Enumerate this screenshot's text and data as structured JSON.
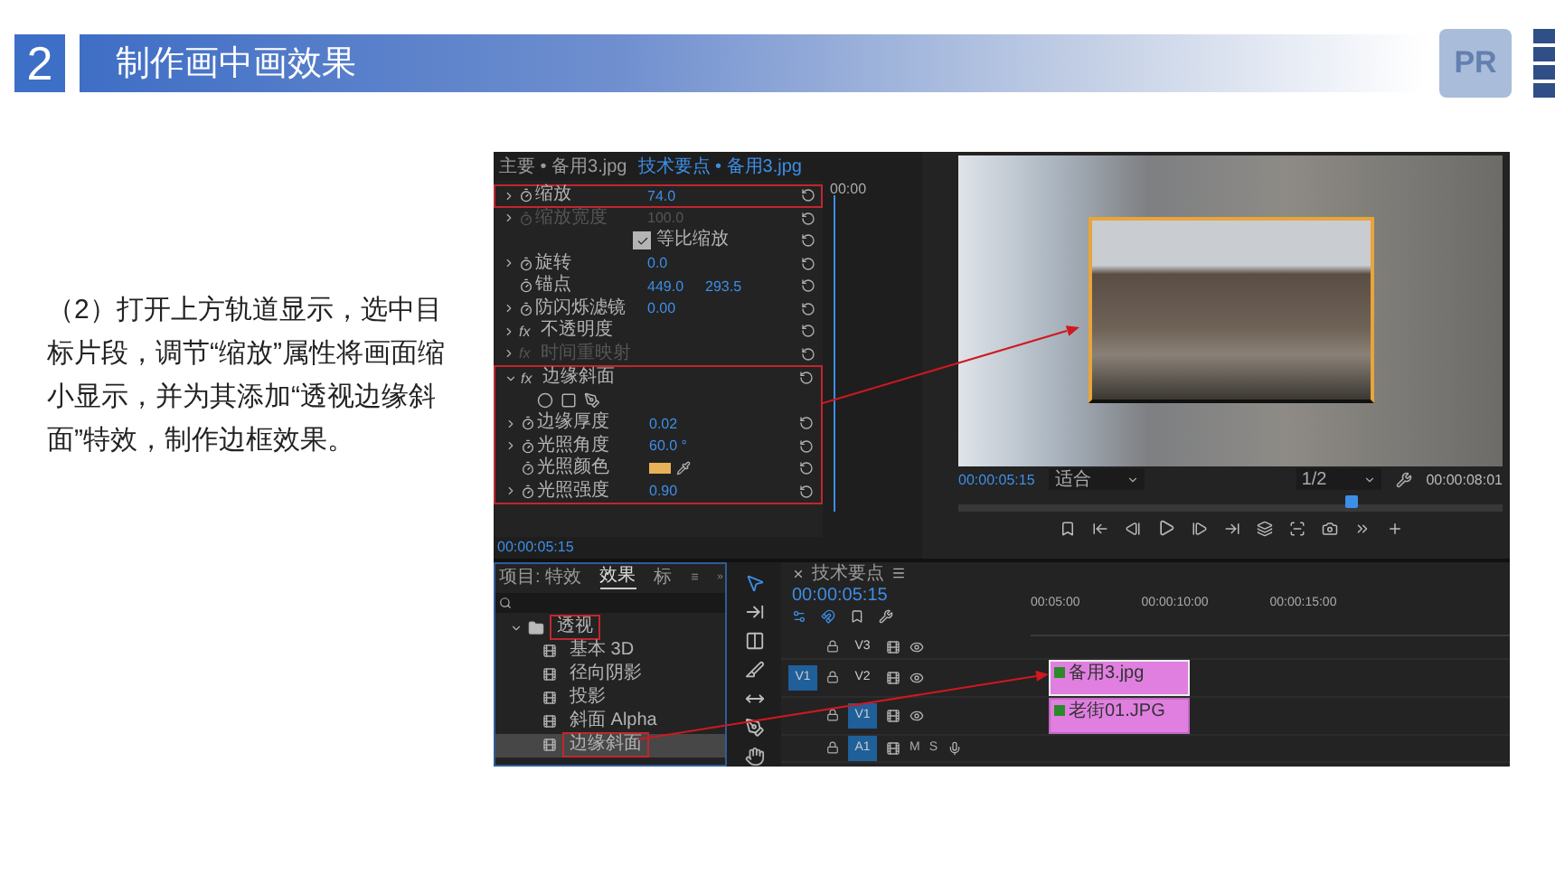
{
  "header": {
    "number": "2",
    "title": "制作画中画效果",
    "logo": "PR"
  },
  "instruction": "（2）打开上方轨道显示，选中目标片段，调节“缩放”属性将画面缩小显示，并为其添加“透视边缘斜面”特效，制作边框效果。",
  "effect_controls": {
    "tabs": [
      {
        "label": "主要 • 备用3.jpg",
        "selected": false
      },
      {
        "label": "技术要点 • 备用3.jpg",
        "selected": true
      }
    ],
    "ruler_label": "00:00",
    "rows": [
      {
        "kind": "property",
        "label": "缩放",
        "values": [
          "74.0"
        ],
        "expandable": true,
        "disabled": false,
        "highlighted": true
      },
      {
        "kind": "property",
        "label": "缩放宽度",
        "values": [
          "100.0"
        ],
        "expandable": true,
        "disabled": true,
        "highlighted": false
      },
      {
        "kind": "checkbox",
        "label": "等比缩放",
        "checked": true
      },
      {
        "kind": "property",
        "label": "旋转",
        "values": [
          "0.0"
        ],
        "expandable": true,
        "disabled": false,
        "highlighted": false
      },
      {
        "kind": "property",
        "label": "锚点",
        "values": [
          "449.0",
          "293.5"
        ],
        "expandable": false,
        "disabled": false,
        "highlighted": false
      },
      {
        "kind": "property",
        "label": "防闪烁滤镜",
        "values": [
          "0.00"
        ],
        "expandable": true,
        "disabled": false,
        "highlighted": false
      },
      {
        "kind": "section",
        "icon_text": "fx",
        "label": "不透明度",
        "disabled": false,
        "expanded": false,
        "highlighted": false
      },
      {
        "kind": "section",
        "icon_text": "fx",
        "label": "时间重映射",
        "disabled": true,
        "expanded": false,
        "highlighted": false
      },
      {
        "kind": "section",
        "icon_text": "fx",
        "label": "边缘斜面",
        "disabled": false,
        "expanded": true,
        "highlighted": true,
        "children": [
          {
            "kind": "mask_tools"
          },
          {
            "kind": "property",
            "label": "边缘厚度",
            "values": [
              "0.02"
            ],
            "expandable": true,
            "disabled": false,
            "highlighted": false
          },
          {
            "kind": "property",
            "label": "光照角度",
            "values": [
              "60.0 °"
            ],
            "expandable": true,
            "disabled": false,
            "highlighted": false
          },
          {
            "kind": "color",
            "label": "光照颜色"
          },
          {
            "kind": "property",
            "label": "光照强度",
            "values": [
              "0.90"
            ],
            "expandable": true,
            "disabled": false,
            "highlighted": false
          }
        ]
      }
    ],
    "timecode": "00:00:05:15"
  },
  "program_monitor": {
    "timecode": "00:00:05:15",
    "zoom": "适合",
    "resolution": "1/2",
    "duration": "00:00:08:01",
    "playhead": {
      "level": 0.72
    }
  },
  "effects_panel": {
    "tabs": [
      {
        "label": "项目: 特效",
        "selected": false
      },
      {
        "label": "效果",
        "selected": true
      },
      {
        "label": "标",
        "selected": false
      }
    ],
    "tree": [
      {
        "label": "透视",
        "expanded": true,
        "highlighted": true,
        "children": [
          {
            "label": "基本 3D",
            "selected": false,
            "highlighted": false
          },
          {
            "label": "径向阴影",
            "selected": false,
            "highlighted": false
          },
          {
            "label": "投影",
            "selected": false,
            "highlighted": false
          },
          {
            "label": "斜面 Alpha",
            "selected": false,
            "highlighted": false
          },
          {
            "label": "边缘斜面",
            "selected": true,
            "highlighted": true
          }
        ]
      }
    ]
  },
  "tools": [
    {
      "kind": "selection",
      "selected": true
    },
    {
      "kind": "track_select",
      "selected": false
    },
    {
      "kind": "ripple",
      "selected": false
    },
    {
      "kind": "razor",
      "selected": false
    },
    {
      "kind": "slip",
      "selected": false
    },
    {
      "kind": "pen",
      "selected": false
    }
  ],
  "timeline": {
    "title": "技术要点",
    "timecode": "00:00:05:15",
    "ruler_labels": [
      "00:05:00",
      "00:00:10:00",
      "00:00:15:00"
    ],
    "tracks": [
      {
        "kind": "video",
        "name": "V3",
        "targeted": false
      },
      {
        "kind": "video",
        "name": "V2",
        "source": "V1",
        "targeted": false,
        "clip": {
          "label": "备用3.jpg",
          "selected": true
        }
      },
      {
        "kind": "video",
        "name": "V1",
        "targeted": true,
        "clip": {
          "label": "老街01.JPG",
          "selected": false
        }
      },
      {
        "kind": "audio",
        "name": "A1",
        "targeted": true,
        "mute": "M",
        "solo": "S"
      }
    ]
  }
}
